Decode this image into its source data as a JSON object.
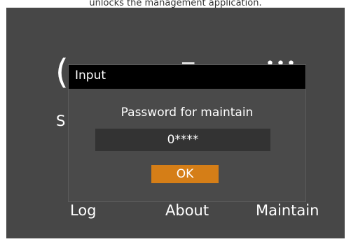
{
  "caption": "unlocks the management application.",
  "background": {
    "icons": [
      "settings-icon",
      "menu-icon",
      "more-icon"
    ],
    "labels": {
      "settings_partial": "S",
      "log": "Log",
      "about": "About",
      "maintain": "Maintain"
    }
  },
  "dialog": {
    "title": "Input",
    "prompt": "Password for maintain",
    "password_value": "0****",
    "ok_label": "OK"
  },
  "colors": {
    "screen_bg": "#474747",
    "titlebar_bg": "#000000",
    "field_bg": "#333333",
    "ok_button": "#d57e17"
  }
}
